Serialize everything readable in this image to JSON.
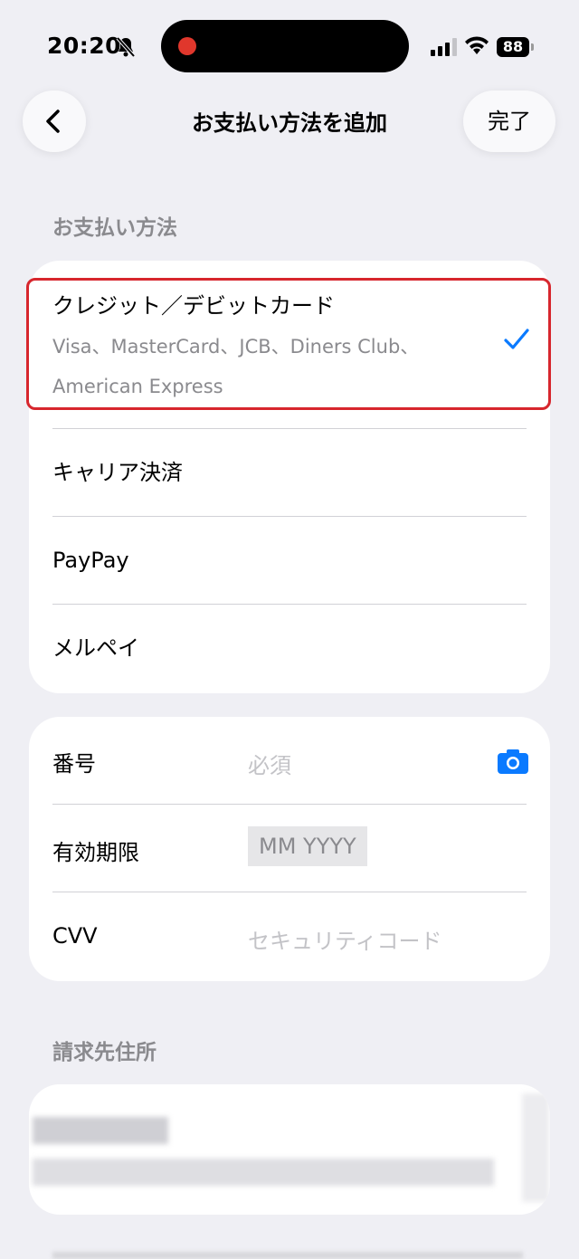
{
  "status": {
    "time": "20:20",
    "battery": "88"
  },
  "nav": {
    "title": "お支払い方法を追加",
    "done_label": "完了"
  },
  "payment_section": {
    "header": "お支払い方法",
    "methods": [
      {
        "label": "クレジット／デビットカード",
        "sub1": "Visa、MasterCard、JCB、Diners Club、",
        "sub2": "American Express",
        "selected": true
      },
      {
        "label": "キャリア決済"
      },
      {
        "label": "PayPay"
      },
      {
        "label": "メルペイ"
      }
    ]
  },
  "card_form": {
    "number_label": "番号",
    "number_placeholder": "必須",
    "expiry_label": "有効期限",
    "expiry_placeholder": "MM YYYY",
    "cvv_label": "CVV",
    "cvv_placeholder": "セキュリティコード"
  },
  "billing": {
    "header": "請求先住所"
  },
  "colors": {
    "accent": "#0a7aff",
    "highlight_border": "#d7262d"
  },
  "icons": [
    "bell-slash-icon",
    "signal-icon",
    "wifi-icon",
    "battery-icon",
    "chevron-left-icon",
    "checkmark-icon",
    "camera-icon"
  ]
}
